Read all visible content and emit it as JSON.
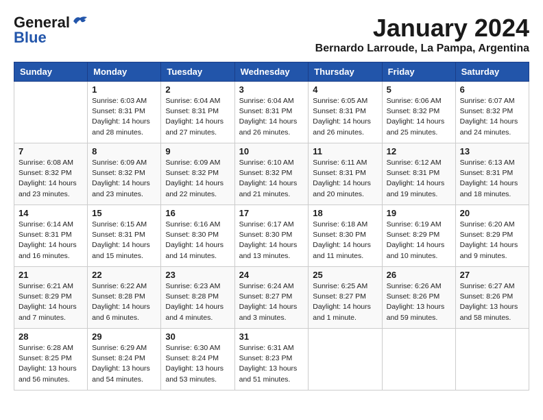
{
  "header": {
    "logo_line1": "General",
    "logo_line2": "Blue",
    "month_title": "January 2024",
    "location": "Bernardo Larroude, La Pampa, Argentina"
  },
  "weekdays": [
    "Sunday",
    "Monday",
    "Tuesday",
    "Wednesday",
    "Thursday",
    "Friday",
    "Saturday"
  ],
  "weeks": [
    [
      {
        "day": "",
        "sunrise": "",
        "sunset": "",
        "daylight": ""
      },
      {
        "day": "1",
        "sunrise": "6:03 AM",
        "sunset": "8:31 PM",
        "daylight": "14 hours and 28 minutes."
      },
      {
        "day": "2",
        "sunrise": "6:04 AM",
        "sunset": "8:31 PM",
        "daylight": "14 hours and 27 minutes."
      },
      {
        "day": "3",
        "sunrise": "6:04 AM",
        "sunset": "8:31 PM",
        "daylight": "14 hours and 26 minutes."
      },
      {
        "day": "4",
        "sunrise": "6:05 AM",
        "sunset": "8:31 PM",
        "daylight": "14 hours and 26 minutes."
      },
      {
        "day": "5",
        "sunrise": "6:06 AM",
        "sunset": "8:32 PM",
        "daylight": "14 hours and 25 minutes."
      },
      {
        "day": "6",
        "sunrise": "6:07 AM",
        "sunset": "8:32 PM",
        "daylight": "14 hours and 24 minutes."
      }
    ],
    [
      {
        "day": "7",
        "sunrise": "6:08 AM",
        "sunset": "8:32 PM",
        "daylight": "14 hours and 23 minutes."
      },
      {
        "day": "8",
        "sunrise": "6:09 AM",
        "sunset": "8:32 PM",
        "daylight": "14 hours and 23 minutes."
      },
      {
        "day": "9",
        "sunrise": "6:09 AM",
        "sunset": "8:32 PM",
        "daylight": "14 hours and 22 minutes."
      },
      {
        "day": "10",
        "sunrise": "6:10 AM",
        "sunset": "8:32 PM",
        "daylight": "14 hours and 21 minutes."
      },
      {
        "day": "11",
        "sunrise": "6:11 AM",
        "sunset": "8:31 PM",
        "daylight": "14 hours and 20 minutes."
      },
      {
        "day": "12",
        "sunrise": "6:12 AM",
        "sunset": "8:31 PM",
        "daylight": "14 hours and 19 minutes."
      },
      {
        "day": "13",
        "sunrise": "6:13 AM",
        "sunset": "8:31 PM",
        "daylight": "14 hours and 18 minutes."
      }
    ],
    [
      {
        "day": "14",
        "sunrise": "6:14 AM",
        "sunset": "8:31 PM",
        "daylight": "14 hours and 16 minutes."
      },
      {
        "day": "15",
        "sunrise": "6:15 AM",
        "sunset": "8:31 PM",
        "daylight": "14 hours and 15 minutes."
      },
      {
        "day": "16",
        "sunrise": "6:16 AM",
        "sunset": "8:30 PM",
        "daylight": "14 hours and 14 minutes."
      },
      {
        "day": "17",
        "sunrise": "6:17 AM",
        "sunset": "8:30 PM",
        "daylight": "14 hours and 13 minutes."
      },
      {
        "day": "18",
        "sunrise": "6:18 AM",
        "sunset": "8:30 PM",
        "daylight": "14 hours and 11 minutes."
      },
      {
        "day": "19",
        "sunrise": "6:19 AM",
        "sunset": "8:29 PM",
        "daylight": "14 hours and 10 minutes."
      },
      {
        "day": "20",
        "sunrise": "6:20 AM",
        "sunset": "8:29 PM",
        "daylight": "14 hours and 9 minutes."
      }
    ],
    [
      {
        "day": "21",
        "sunrise": "6:21 AM",
        "sunset": "8:29 PM",
        "daylight": "14 hours and 7 minutes."
      },
      {
        "day": "22",
        "sunrise": "6:22 AM",
        "sunset": "8:28 PM",
        "daylight": "14 hours and 6 minutes."
      },
      {
        "day": "23",
        "sunrise": "6:23 AM",
        "sunset": "8:28 PM",
        "daylight": "14 hours and 4 minutes."
      },
      {
        "day": "24",
        "sunrise": "6:24 AM",
        "sunset": "8:27 PM",
        "daylight": "14 hours and 3 minutes."
      },
      {
        "day": "25",
        "sunrise": "6:25 AM",
        "sunset": "8:27 PM",
        "daylight": "14 hours and 1 minute."
      },
      {
        "day": "26",
        "sunrise": "6:26 AM",
        "sunset": "8:26 PM",
        "daylight": "13 hours and 59 minutes."
      },
      {
        "day": "27",
        "sunrise": "6:27 AM",
        "sunset": "8:26 PM",
        "daylight": "13 hours and 58 minutes."
      }
    ],
    [
      {
        "day": "28",
        "sunrise": "6:28 AM",
        "sunset": "8:25 PM",
        "daylight": "13 hours and 56 minutes."
      },
      {
        "day": "29",
        "sunrise": "6:29 AM",
        "sunset": "8:24 PM",
        "daylight": "13 hours and 54 minutes."
      },
      {
        "day": "30",
        "sunrise": "6:30 AM",
        "sunset": "8:24 PM",
        "daylight": "13 hours and 53 minutes."
      },
      {
        "day": "31",
        "sunrise": "6:31 AM",
        "sunset": "8:23 PM",
        "daylight": "13 hours and 51 minutes."
      },
      {
        "day": "",
        "sunrise": "",
        "sunset": "",
        "daylight": ""
      },
      {
        "day": "",
        "sunrise": "",
        "sunset": "",
        "daylight": ""
      },
      {
        "day": "",
        "sunrise": "",
        "sunset": "",
        "daylight": ""
      }
    ]
  ]
}
